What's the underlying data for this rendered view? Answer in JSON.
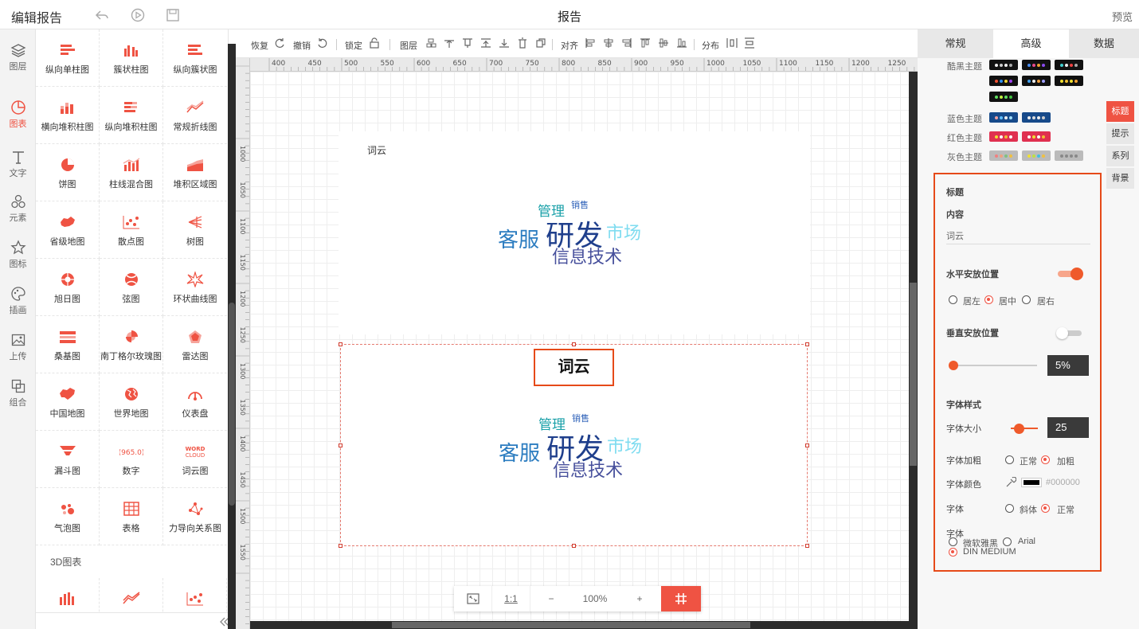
{
  "header": {
    "app_title": "编辑报告",
    "page_title": "报告",
    "preview": "预览"
  },
  "rail": [
    {
      "label": "图层",
      "icon": "layers-icon"
    },
    {
      "label": "图表",
      "icon": "chart-pie-icon",
      "active": true
    },
    {
      "label": "文字",
      "icon": "text-icon"
    },
    {
      "label": "元素",
      "icon": "elements-icon"
    },
    {
      "label": "图标",
      "icon": "star-icon"
    },
    {
      "label": "插画",
      "icon": "palette-icon"
    },
    {
      "label": "上传",
      "icon": "upload-image-icon"
    },
    {
      "label": "组合",
      "icon": "group-icon"
    }
  ],
  "components": [
    "纵向单柱图",
    "簇状柱图",
    "纵向簇状图",
    "横向堆积柱图",
    "纵向堆积柱图",
    "常规折线图",
    "饼图",
    "柱线混合图",
    "堆积区域图",
    "省级地图",
    "散点图",
    "树图",
    "旭日图",
    "弦图",
    "环状曲线图",
    "桑基图",
    "南丁格尔玫瑰图",
    "雷达图",
    "中国地图",
    "世界地图",
    "仪表盘",
    "漏斗图",
    "数字",
    "词云图",
    "气泡图",
    "表格",
    "力导向关系图"
  ],
  "component_icon_texts": {
    "number": "965.0",
    "word_cloud_1": "WORD",
    "word_cloud_2": "CLOUD"
  },
  "section_3d": "3D图表",
  "toolbar": {
    "redo": "恢复",
    "undo": "撤销",
    "lock": "锁定",
    "layer": "图层",
    "align": "对齐",
    "distribute": "分布"
  },
  "ruler_labels": [
    "400",
    "450",
    "500",
    "550",
    "600",
    "650",
    "700",
    "750",
    "800",
    "850",
    "900",
    "950",
    "1000",
    "1050",
    "1100",
    "1150",
    "1200",
    "1250"
  ],
  "ruler_v_labels": [
    "1000",
    "1050",
    "1100",
    "1150",
    "1200",
    "1250",
    "1300",
    "1350",
    "1400",
    "1450",
    "1500",
    "1550"
  ],
  "widget1": {
    "title": "词云"
  },
  "widget2": {
    "title": "词云"
  },
  "word_cloud": [
    {
      "text": "研发",
      "color": "#1f3f8c"
    },
    {
      "text": "客服",
      "color": "#2b7cc0"
    },
    {
      "text": "市场",
      "color": "#7fdcf0"
    },
    {
      "text": "信息技术",
      "color": "#47509c"
    },
    {
      "text": "管理",
      "color": "#19a0a8"
    },
    {
      "text": "销售",
      "color": "#2b5fb8"
    }
  ],
  "zoom": {
    "ratio": "1:1",
    "minus": "−",
    "value": "100%",
    "plus": "+"
  },
  "right_panel": {
    "tabs": [
      "常规",
      "高级",
      "数据"
    ],
    "active_tab": "高级",
    "themes": {
      "dark": "酷黑主题",
      "blue": "蓝色主题",
      "red": "红色主题",
      "gray": "灰色主题"
    },
    "side_tabs": [
      "标题",
      "提示",
      "系列",
      "背景"
    ],
    "title": {
      "section": "标题",
      "content_label": "内容",
      "content_value": "词云",
      "h_pos_label": "水平安放位置",
      "h_options": [
        "居左",
        "居中",
        "居右"
      ],
      "h_selected": "居中",
      "v_pos_label": "垂直安放位置",
      "v_value": "5%",
      "font_style_label": "字体样式",
      "font_size_label": "字体大小",
      "font_size": "25",
      "bold_label": "字体加粗",
      "bold_options": [
        "正常",
        "加粗"
      ],
      "bold_selected": "加粗",
      "color_label": "字体颜色",
      "color_value": "#000000",
      "italic_label": "字体",
      "italic_options": [
        "斜体",
        "正常"
      ],
      "italic_selected": "正常",
      "family_label": "字体",
      "family_options": [
        "微软雅黑",
        "Arial",
        "DIN MEDIUM"
      ],
      "family_selected": "DIN MEDIUM"
    }
  },
  "colors": {
    "accent": "#ef5343",
    "highlight_border": "#e64a19"
  }
}
